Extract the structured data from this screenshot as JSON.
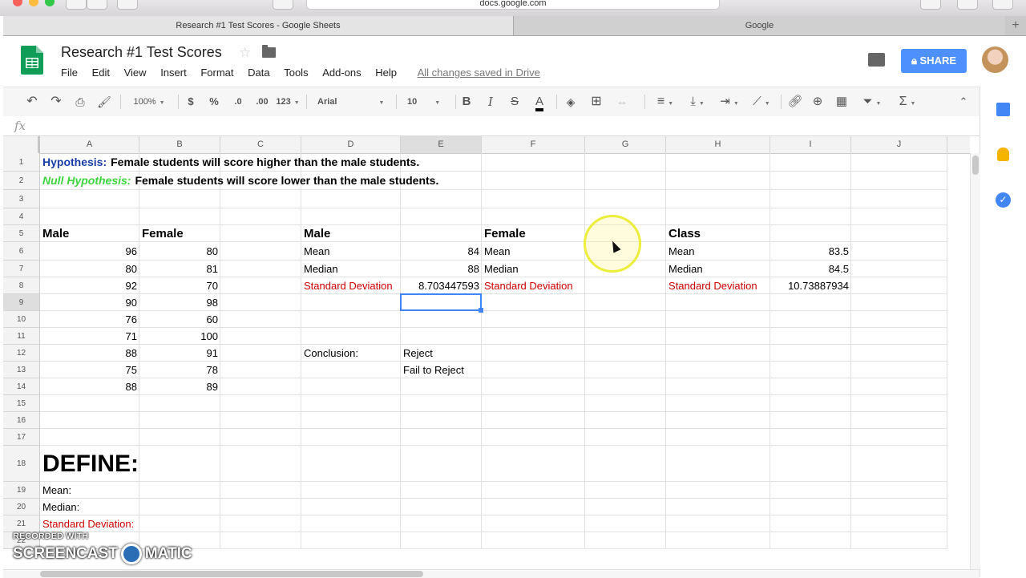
{
  "browser": {
    "url": "docs.google.com",
    "tabs": [
      {
        "label": "Research #1 Test Scores - Google Sheets"
      },
      {
        "label": "Google"
      }
    ],
    "new_tab_label": "+"
  },
  "header": {
    "title": "Research #1 Test Scores",
    "menu": [
      "File",
      "Edit",
      "View",
      "Insert",
      "Format",
      "Data",
      "Tools",
      "Add-ons",
      "Help"
    ],
    "save_status": "All changes saved in Drive",
    "share_label": "SHARE"
  },
  "toolbar": {
    "zoom": "100%",
    "currency": "$",
    "percent": "%",
    "decimal_decrease": ".0",
    "decimal_increase": ".00",
    "number_format": "123",
    "font": "Arial",
    "font_size": "10",
    "bold": "B",
    "italic": "I",
    "strike": "S",
    "text_color": "A"
  },
  "formula_bar": {
    "label": "fx"
  },
  "columns": [
    "A",
    "B",
    "C",
    "D",
    "E",
    "F",
    "G",
    "H",
    "I",
    "J"
  ],
  "rows": [
    "1",
    "2",
    "3",
    "4",
    "5",
    "6",
    "7",
    "8",
    "9",
    "10",
    "11",
    "12",
    "13",
    "14",
    "15",
    "16",
    "17",
    "18",
    "19",
    "20",
    "21",
    "22"
  ],
  "cells": {
    "A1_label": "Hypothesis:",
    "A1_text": "Female students will score higher than the male students.",
    "A2_label": "Null Hypothesis:",
    "A2_text": "Female students will score lower than the male students.",
    "A5": "Male",
    "B5": "Female",
    "D5": "Male",
    "F5": "Female",
    "H5": "Class",
    "male_scores": [
      "96",
      "80",
      "92",
      "90",
      "76",
      "71",
      "88",
      "75",
      "88"
    ],
    "female_scores": [
      "80",
      "81",
      "70",
      "98",
      "60",
      "100",
      "91",
      "78",
      "89"
    ],
    "D6": "Mean",
    "E6": "84",
    "D7": "Median",
    "E7": "88",
    "D8": "Standard Deviation",
    "E8": "8.703447593",
    "F6": "Mean",
    "F7": "Median",
    "F8": "Standard Deviation",
    "H6": "Mean",
    "I6": "83.5",
    "H7": "Median",
    "I7": "84.5",
    "H8": "Standard Deviation",
    "I8": "10.73887934",
    "D12": "Conclusion:",
    "E12": "Reject",
    "E13": "Fail to Reject",
    "A18": "DEFINE:",
    "A19": "Mean:",
    "A20": "Median:",
    "A21": "Standard Deviation:"
  },
  "selected_cell": "E9",
  "watermark": {
    "top": "RECORDED WITH",
    "left": "SCREENCAST",
    "right": "MATIC"
  },
  "colors": {
    "accent": "#4285f4",
    "share": "#4d90fe",
    "sheets_green": "#0f9d58",
    "red_text": "#cc0000",
    "hypothesis_blue": "#1a3da8",
    "null_green": "#3fd43f"
  }
}
